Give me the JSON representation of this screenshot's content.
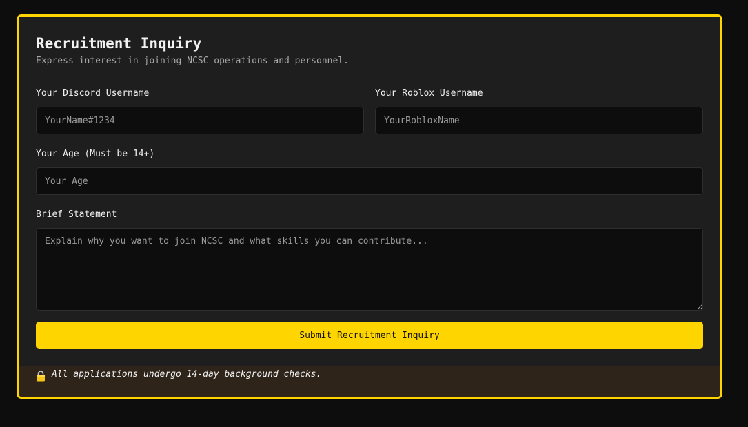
{
  "form": {
    "title": "Recruitment Inquiry",
    "subtitle": "Express interest in joining NCSC operations and personnel.",
    "fields": {
      "discord": {
        "label": "Your Discord Username",
        "placeholder": "YourName#1234",
        "value": ""
      },
      "roblox": {
        "label": "Your Roblox Username",
        "placeholder": "YourRobloxName",
        "value": ""
      },
      "age": {
        "label": "Your Age (Must be 14+)",
        "placeholder": "Your Age",
        "value": ""
      },
      "statement": {
        "label": "Brief Statement",
        "placeholder": "Explain why you want to join NCSC and what skills you can contribute...",
        "value": ""
      }
    },
    "submit_label": "Submit Recruitment Inquiry",
    "notice": {
      "icon": "lock-icon",
      "text": "All applications undergo 14-day background checks."
    }
  },
  "colors": {
    "accent": "#ffd500",
    "background": "#0d0d0d",
    "card": "#1e1e1e",
    "notice_background": "#2e241a"
  }
}
